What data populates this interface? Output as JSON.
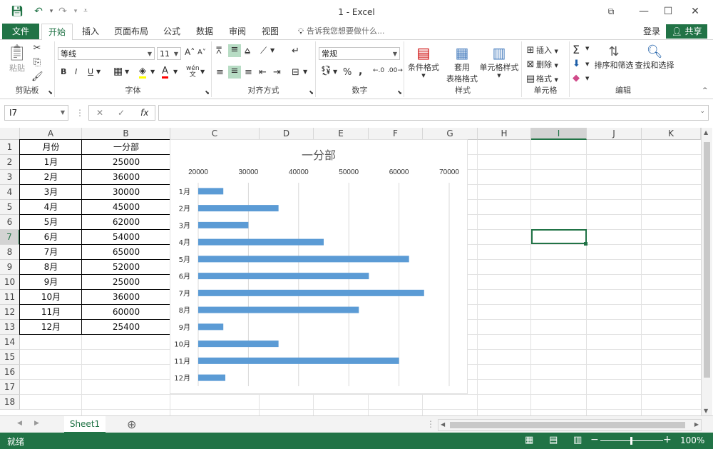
{
  "titlebar": {
    "title": "1 - Excel"
  },
  "tabs": {
    "file": "文件",
    "home": "开始",
    "insert": "插入",
    "layout": "页面布局",
    "formulas": "公式",
    "data": "数据",
    "review": "审阅",
    "view": "视图",
    "tellme": "告诉我您想要做什么...",
    "login": "登录",
    "share": "共享"
  },
  "ribbon": {
    "clipboard": {
      "label": "剪贴板",
      "paste": "粘贴"
    },
    "font": {
      "label": "字体",
      "name": "等线",
      "size": "11",
      "bold": "B",
      "italic": "I",
      "underline": "U",
      "grow": "A",
      "shrink": "A",
      "font_color": "A",
      "wen": "wén"
    },
    "align": {
      "label": "对齐方式"
    },
    "number": {
      "label": "数字",
      "format": "常规",
      "percent": "%",
      "comma": ","
    },
    "styles": {
      "label": "样式",
      "conditional": "条件格式",
      "table_a": "套用",
      "table_b": "表格格式",
      "cell_styles": "单元格样式"
    },
    "cells": {
      "label": "单元格",
      "insert": "插入",
      "delete": "删除",
      "format": "格式"
    },
    "editing": {
      "label": "编辑",
      "sort": "排序和筛选",
      "find": "查找和选择"
    }
  },
  "formula": {
    "namebox": "I7",
    "fx": "fx"
  },
  "columns": [
    "A",
    "B",
    "C",
    "D",
    "E",
    "F",
    "G",
    "H",
    "I",
    "J",
    "K"
  ],
  "rows": [
    "1",
    "2",
    "3",
    "4",
    "5",
    "6",
    "7",
    "8",
    "9",
    "10",
    "11",
    "12",
    "13",
    "14",
    "15",
    "16",
    "17",
    "18"
  ],
  "table": {
    "header": [
      "月份",
      "一分部"
    ],
    "rows": [
      [
        "1月",
        "25000"
      ],
      [
        "2月",
        "36000"
      ],
      [
        "3月",
        "30000"
      ],
      [
        "4月",
        "45000"
      ],
      [
        "5月",
        "62000"
      ],
      [
        "6月",
        "54000"
      ],
      [
        "7月",
        "65000"
      ],
      [
        "8月",
        "52000"
      ],
      [
        "9月",
        "25000"
      ],
      [
        "10月",
        "36000"
      ],
      [
        "11月",
        "60000"
      ],
      [
        "12月",
        "25400"
      ]
    ]
  },
  "chart_data": {
    "type": "bar",
    "orientation": "horizontal",
    "title": "一分部",
    "categories": [
      "1月",
      "2月",
      "3月",
      "4月",
      "5月",
      "6月",
      "7月",
      "8月",
      "9月",
      "10月",
      "11月",
      "12月"
    ],
    "values": [
      25000,
      36000,
      30000,
      45000,
      62000,
      54000,
      65000,
      52000,
      25000,
      36000,
      60000,
      25400
    ],
    "xlim": [
      20000,
      70000
    ],
    "xticks": [
      "20000",
      "30000",
      "40000",
      "50000",
      "60000",
      "70000"
    ],
    "axis_position": "top",
    "grid": true,
    "bar_color": "#5b9bd5"
  },
  "sheets": {
    "active": "Sheet1",
    "add": "⊕"
  },
  "status": {
    "ready": "就绪",
    "zoom": "100%"
  },
  "colors": {
    "accent": "#217346"
  }
}
